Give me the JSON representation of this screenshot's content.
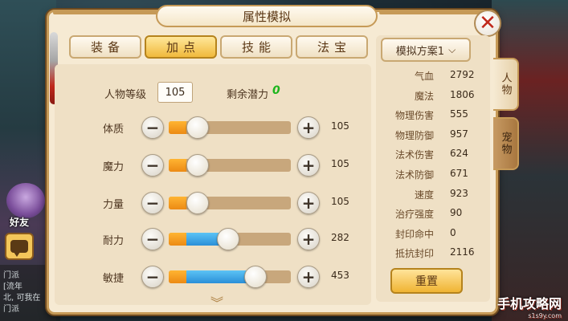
{
  "window": {
    "title": "属性模拟"
  },
  "tabs": [
    {
      "label": "装备",
      "active": false
    },
    {
      "label": "加点",
      "active": true
    },
    {
      "label": "技能",
      "active": false
    },
    {
      "label": "法宝",
      "active": false
    }
  ],
  "character": {
    "level_label": "人物等级",
    "level_value": "105",
    "potential_label": "剩余潜力",
    "potential_value": "0"
  },
  "stats": [
    {
      "label": "体质",
      "value": "105",
      "fill": 0.0
    },
    {
      "label": "魔力",
      "value": "105",
      "fill": 0.0
    },
    {
      "label": "力量",
      "value": "105",
      "fill": 0.0
    },
    {
      "label": "耐力",
      "value": "282",
      "fill": 0.37
    },
    {
      "label": "敏捷",
      "value": "453",
      "fill": 0.71
    }
  ],
  "scheme": {
    "selected": "模拟方案1"
  },
  "attributes": [
    {
      "label": "气血",
      "value": "2792"
    },
    {
      "label": "魔法",
      "value": "1806"
    },
    {
      "label": "物理伤害",
      "value": "555"
    },
    {
      "label": "物理防御",
      "value": "957"
    },
    {
      "label": "法术伤害",
      "value": "624"
    },
    {
      "label": "法术防御",
      "value": "671"
    },
    {
      "label": "速度",
      "value": "923"
    },
    {
      "label": "治疗强度",
      "value": "90"
    },
    {
      "label": "封印命中",
      "value": "0"
    },
    {
      "label": "抵抗封印",
      "value": "2116"
    }
  ],
  "reset_label": "重置",
  "side_tabs": [
    {
      "label": "人物",
      "active": true
    },
    {
      "label": "宠物",
      "active": false
    }
  ],
  "background": {
    "friend_label": "好友",
    "chat_lines": [
      "门派",
      "[流年",
      "北, 可我在",
      "门派"
    ]
  },
  "watermark": {
    "main": "手机攻略网",
    "sub": "s1s9y.com"
  },
  "colors": {
    "panel_bg": "#f6ead3",
    "accent_gold": "#f0b93c",
    "fill_orange": "#ec8a14",
    "fill_blue": "#2a8fd8",
    "potential_green": "#1db51d",
    "close_red": "#c0281c"
  }
}
